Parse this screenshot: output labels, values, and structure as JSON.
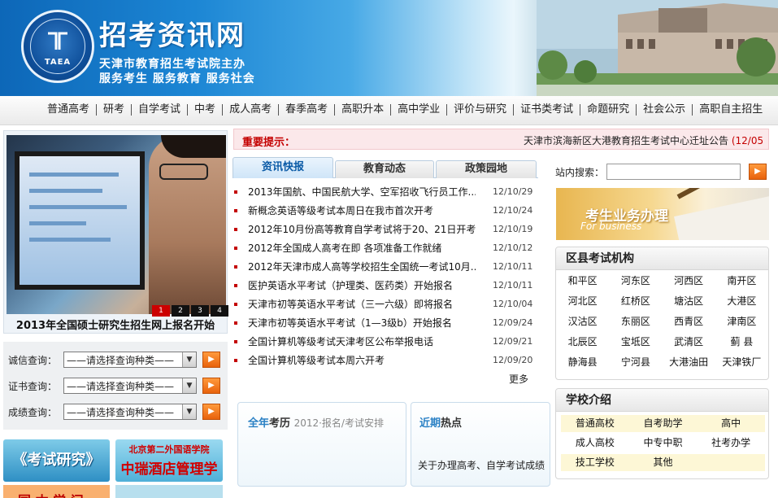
{
  "header": {
    "logo_text": "TAEA",
    "site_title": "招考资讯网",
    "sub_line1": "天津市教育招生考试院主办",
    "sub_line2": "服务考生 服务教育 服务社会"
  },
  "nav": [
    "普通高考",
    "研考",
    "自学考试",
    "中考",
    "成人高考",
    "春季高考",
    "高职升本",
    "高中学业",
    "评价与研究",
    "证书类考试",
    "命题研究",
    "社会公示",
    "高职自主招生"
  ],
  "slider": {
    "caption": "2013年全国硕士研究生招生网上报名开始",
    "pages": [
      "1",
      "2",
      "3",
      "4"
    ]
  },
  "query": {
    "integrity_label": "诚信查询：",
    "cert_label": "证书查询：",
    "score_label": "成绩查询：",
    "select_placeholder": "——请选择查询种类——",
    "arrow": "▼",
    "go": "▶"
  },
  "promos": {
    "exam_research": "《考试研究》",
    "hotel_line1": "北京第二外国语学院",
    "hotel_line2": "中瑞酒店管理学院",
    "bottom_left": "国 本 学 问"
  },
  "notice": {
    "label": "重要提示：",
    "text": "天津市滨海新区大港教育招生考试中心迁址公告",
    "date": "(12/05"
  },
  "tabs": [
    "资讯快报",
    "教育动态",
    "政策园地"
  ],
  "news": [
    {
      "title": "2013年国航、中国民航大学、空军招收飞行员工作...",
      "date": "12/10/29"
    },
    {
      "title": "新概念英语等级考试本周日在我市首次开考",
      "date": "12/10/24"
    },
    {
      "title": "2012年10月份高等教育自学考试将于20、21日开考",
      "date": "12/10/19"
    },
    {
      "title": "2012年全国成人高考在即 各项准备工作就绪",
      "date": "12/10/12"
    },
    {
      "title": "2012年天津市成人高等学校招生全国统一考试10月...",
      "date": "12/10/11"
    },
    {
      "title": "医护英语水平考试（护理类、医药类）开始报名",
      "date": "12/10/11"
    },
    {
      "title": "天津市初等英语水平考试（三一六级）即将报名",
      "date": "12/10/04"
    },
    {
      "title": "天津市初等英语水平考试（1—3级b）开始报名",
      "date": "12/09/24"
    },
    {
      "title": "全国计算机等级考试天津考区公布举报电话",
      "date": "12/09/21"
    },
    {
      "title": "全国计算机等级考试本周六开考",
      "date": "12/09/20"
    }
  ],
  "more": "更多",
  "calendar": {
    "h1": "全年",
    "h2": "考历",
    "h3": "2012·报名/考试安排"
  },
  "hot": {
    "h1": "近期",
    "h2": "热点",
    "text": "关于办理高考、自学考试成绩"
  },
  "search": {
    "label": "站内搜索：",
    "placeholder": "",
    "go": "▶"
  },
  "business": {
    "title": "考生业务办理",
    "subtitle": "For business"
  },
  "districts": {
    "title": "区县考试机构",
    "items": [
      "和平区",
      "河东区",
      "河西区",
      "南开区",
      "河北区",
      "红桥区",
      "塘沽区",
      "大港区",
      "汉沽区",
      "东丽区",
      "西青区",
      "津南区",
      "北辰区",
      "宝坻区",
      "武清区",
      "蓟  县",
      "静海县",
      "宁河县",
      "大港油田",
      "天津铁厂"
    ]
  },
  "schools": {
    "title": "学校介绍",
    "items": [
      "普通高校",
      "自考助学",
      "高中",
      "成人高校",
      "中专中职",
      "社考办学",
      "技工学校",
      "其他",
      ""
    ]
  }
}
